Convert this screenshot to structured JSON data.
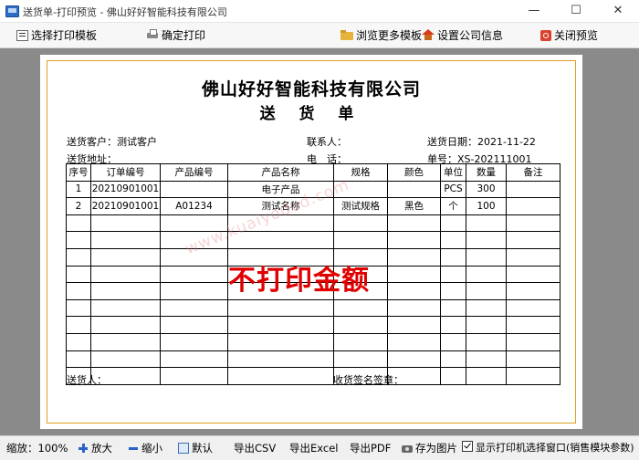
{
  "window": {
    "title": "送货单-打印预览 - 佛山好好智能科技有限公司",
    "minimize_glyph": "—",
    "maximize_glyph": "☐",
    "close_glyph": "✕"
  },
  "toolbar": {
    "select_template": "选择打印模板",
    "confirm_print": "确定打印",
    "browse_templates": "浏览更多模板",
    "company_settings": "设置公司信息",
    "close_preview": "关闭预览"
  },
  "document": {
    "company_name": "佛山好好智能科技有限公司",
    "title": "送 货 单",
    "customer_label": "送货客户：",
    "customer_value": "测试客户",
    "contact_label": "联系人：",
    "date_label": "送货日期：",
    "date_value": "2021-11-22",
    "address_label": "送货地址：",
    "phone_label": "电　话：",
    "number_label": "单号：",
    "number_value": "XS-202111001",
    "columns": [
      "序号",
      "订单编号",
      "产品编号",
      "产品名称",
      "规格",
      "颜色",
      "单位",
      "数量",
      "备注"
    ],
    "rows": [
      [
        "1",
        "20210901001",
        "",
        "电子产品",
        "",
        "",
        "PCS",
        "300",
        ""
      ],
      [
        "2",
        "20210901001",
        "A01234",
        "测试名称",
        "测试规格",
        "黑色",
        "个",
        "100",
        ""
      ],
      [
        "",
        "",
        "",
        "",
        "",
        "",
        "",
        "",
        ""
      ],
      [
        "",
        "",
        "",
        "",
        "",
        "",
        "",
        "",
        ""
      ],
      [
        "",
        "",
        "",
        "",
        "",
        "",
        "",
        "",
        ""
      ],
      [
        "",
        "",
        "",
        "",
        "",
        "",
        "",
        "",
        ""
      ],
      [
        "",
        "",
        "",
        "",
        "",
        "",
        "",
        "",
        ""
      ],
      [
        "",
        "",
        "",
        "",
        "",
        "",
        "",
        "",
        ""
      ],
      [
        "",
        "",
        "",
        "",
        "",
        "",
        "",
        "",
        ""
      ],
      [
        "",
        "",
        "",
        "",
        "",
        "",
        "",
        "",
        ""
      ],
      [
        "",
        "",
        "",
        "",
        "",
        "",
        "",
        "",
        ""
      ],
      [
        "",
        "",
        "",
        "",
        "",
        "",
        "",
        "",
        ""
      ]
    ],
    "no_price_stamp": "不打印金额",
    "watermark": "www.kuaiyoded.com",
    "deliverer_label": "送货人：",
    "receiver_label": "收货签名签章："
  },
  "statusbar": {
    "zoom_label": "缩放：",
    "zoom_value": "100%",
    "zoom_in": "放大",
    "zoom_out": "缩小",
    "default": "默认",
    "export_csv": "导出CSV",
    "export_excel": "导出Excel",
    "export_pdf": "导出PDF",
    "save_image": "存为图片",
    "show_printer_dialog": "显示打印机选择窗口(销售模块参数)",
    "show_printer_dialog_checked": true
  }
}
